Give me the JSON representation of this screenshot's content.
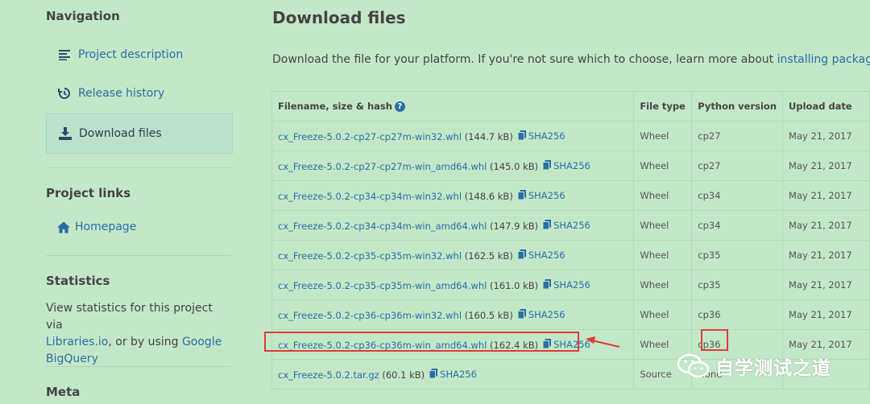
{
  "sidebar": {
    "navigation_heading": "Navigation",
    "items": [
      {
        "label": "Project description",
        "icon": "align-left-icon"
      },
      {
        "label": "Release history",
        "icon": "history-icon"
      },
      {
        "label": "Download files",
        "icon": "download-icon",
        "active": true
      }
    ],
    "project_links_heading": "Project links",
    "homepage_label": "Homepage",
    "statistics_heading": "Statistics",
    "stats_text_1": "View statistics for this project via",
    "stats_link_1": "Libraries.io",
    "stats_text_2": ", or by using",
    "stats_link_2a": "Google",
    "stats_link_2b": "BigQuery",
    "meta_heading": "Meta"
  },
  "main": {
    "title": "Download files",
    "intro_text": "Download the file for your platform. If you're not sure which to choose, learn more about",
    "intro_link": "installing packages",
    "intro_end": "."
  },
  "table": {
    "headers": [
      "Filename, size & hash",
      "File type",
      "Python version",
      "Upload date"
    ],
    "sha_label": "SHA256",
    "rows": [
      {
        "filename": "cx_Freeze-5.0.2-cp27-cp27m-win32.whl",
        "size": "(144.7 kB)",
        "type": "Wheel",
        "python": "cp27",
        "date": "May 21, 2017"
      },
      {
        "filename": "cx_Freeze-5.0.2-cp27-cp27m-win_amd64.whl",
        "size": "(145.0 kB)",
        "type": "Wheel",
        "python": "cp27",
        "date": "May 21, 2017"
      },
      {
        "filename": "cx_Freeze-5.0.2-cp34-cp34m-win32.whl",
        "size": "(148.6 kB)",
        "type": "Wheel",
        "python": "cp34",
        "date": "May 21, 2017"
      },
      {
        "filename": "cx_Freeze-5.0.2-cp34-cp34m-win_amd64.whl",
        "size": "(147.9 kB)",
        "type": "Wheel",
        "python": "cp34",
        "date": "May 21, 2017"
      },
      {
        "filename": "cx_Freeze-5.0.2-cp35-cp35m-win32.whl",
        "size": "(162.5 kB)",
        "type": "Wheel",
        "python": "cp35",
        "date": "May 21, 2017"
      },
      {
        "filename": "cx_Freeze-5.0.2-cp35-cp35m-win_amd64.whl",
        "size": "(161.0 kB)",
        "type": "Wheel",
        "python": "cp35",
        "date": "May 21, 2017"
      },
      {
        "filename": "cx_Freeze-5.0.2-cp36-cp36m-win32.whl",
        "size": "(160.5 kB)",
        "type": "Wheel",
        "python": "cp36",
        "date": "May 21, 2017"
      },
      {
        "filename": "cx_Freeze-5.0.2-cp36-cp36m-win_amd64.whl",
        "size": "(162.4 kB)",
        "type": "Wheel",
        "python": "cp36",
        "date": "May 21, 2017",
        "highlighted": true
      },
      {
        "filename": "cx_Freeze-5.0.2.tar.gz",
        "size": "(60.1 kB)",
        "type": "Source",
        "python": "None",
        "date": ""
      }
    ]
  },
  "annotation": {
    "color": "#e23b3b"
  },
  "watermark": {
    "text": "自学测试之道"
  },
  "colors": {
    "background": "#c3e8c8",
    "link": "#2b6da6"
  }
}
